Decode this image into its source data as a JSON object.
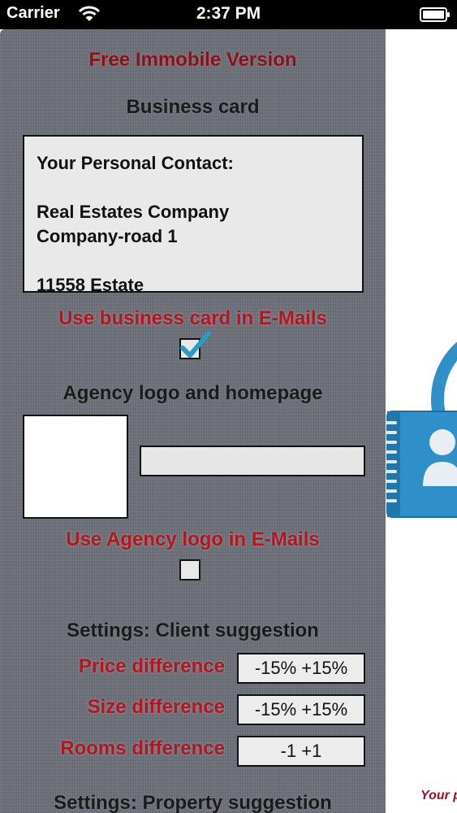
{
  "status_bar": {
    "carrier": "Carrier",
    "time": "2:37 PM"
  },
  "panel": {
    "version_title": "Free Immobile Version",
    "business_card": {
      "heading": "Business card",
      "lines": [
        "Your Personal Contact:",
        "",
        "Real Estates Company",
        "Company-road 1",
        "",
        "11558 Estate"
      ],
      "use_in_emails_label": "Use business card in E-Mails",
      "use_in_emails_checked": true
    },
    "agency": {
      "heading": "Agency logo and homepage",
      "homepage_value": "",
      "use_logo_label": "Use Agency logo in E-Mails",
      "use_logo_checked": false
    },
    "client_suggestion": {
      "heading": "Settings: Client suggestion",
      "rows": [
        {
          "label": "Price difference",
          "value": "-15% +15%"
        },
        {
          "label": "Size difference",
          "value": "-15% +15%"
        },
        {
          "label": "Rooms difference",
          "value": "-1 +1"
        }
      ]
    },
    "property_suggestion": {
      "heading": "Settings: Property suggestion"
    }
  },
  "background": {
    "caption_fragment": "Your p"
  },
  "icons": [
    "wifi-icon",
    "battery-icon",
    "checkmark-icon",
    "contacts-book-icon"
  ],
  "colors": {
    "accent_red": "#b01722",
    "panel_gray": "#6d7079",
    "book_blue": "#2e8fc9"
  }
}
